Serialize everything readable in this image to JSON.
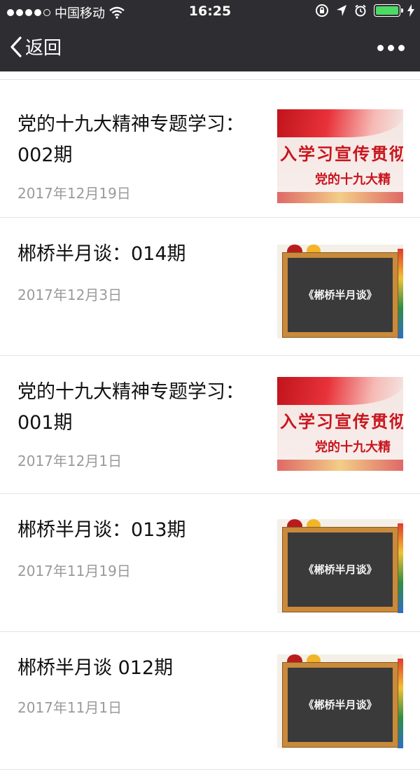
{
  "status": {
    "carrier": "中国移动",
    "time": "16:25",
    "colors": {
      "bar": "#2e2e32",
      "battery": "#4cd964"
    }
  },
  "nav": {
    "back_label": "返回"
  },
  "articles": [
    {
      "title": "党的十九大精神专题学习：002期",
      "date": "2017年12月19日",
      "thumb": {
        "style": "banner",
        "line1": "入学习宣传贯彻",
        "line2": "党的十九大精"
      }
    },
    {
      "title": "郴桥半月谈：014期",
      "date": "2017年12月3日",
      "thumb": {
        "style": "chalkboard",
        "text": "《郴桥半月谈》"
      }
    },
    {
      "title": "党的十九大精神专题学习：001期",
      "date": "2017年12月1日",
      "thumb": {
        "style": "banner",
        "line1": "入学习宣传贯彻",
        "line2": "党的十九大精"
      }
    },
    {
      "title": "郴桥半月谈：013期",
      "date": "2017年11月19日",
      "thumb": {
        "style": "chalkboard",
        "text": "《郴桥半月谈》"
      }
    },
    {
      "title": "郴桥半月谈 012期",
      "date": "2017年11月1日",
      "thumb": {
        "style": "chalkboard",
        "text": "《郴桥半月谈》"
      }
    }
  ]
}
